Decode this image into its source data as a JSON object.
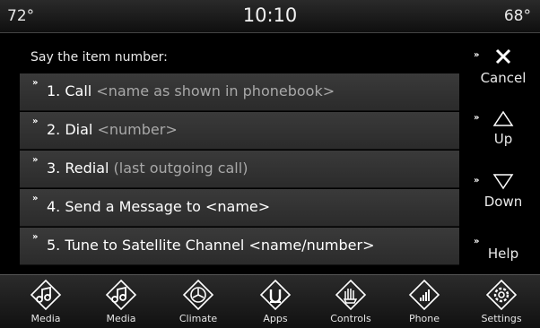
{
  "status": {
    "temp_left": "72°",
    "time": "10:10",
    "temp_right": "68°"
  },
  "prompt": "Say the item number:",
  "items": [
    {
      "main": "1. Call",
      "hint": " <name as shown in phonebook>"
    },
    {
      "main": "2. Dial",
      "hint": " <number>"
    },
    {
      "main": "3. Redial",
      "hint": " (last outgoing call)"
    },
    {
      "main": "4. Send a Message to <name>",
      "hint": ""
    },
    {
      "main": "5. Tune to Satellite Channel <name/number>",
      "hint": ""
    }
  ],
  "side": {
    "cancel": "Cancel",
    "up": "Up",
    "down": "Down",
    "help": "Help"
  },
  "dock": [
    {
      "label": "Media",
      "icon": "music-note-icon"
    },
    {
      "label": "Media",
      "icon": "music-note-icon"
    },
    {
      "label": "Climate",
      "icon": "climate-fan-icon"
    },
    {
      "label": "Apps",
      "icon": "apps-icon"
    },
    {
      "label": "Controls",
      "icon": "controls-hand-icon"
    },
    {
      "label": "Phone",
      "icon": "phone-signal-icon"
    },
    {
      "label": "Settings",
      "icon": "gear-icon"
    }
  ]
}
